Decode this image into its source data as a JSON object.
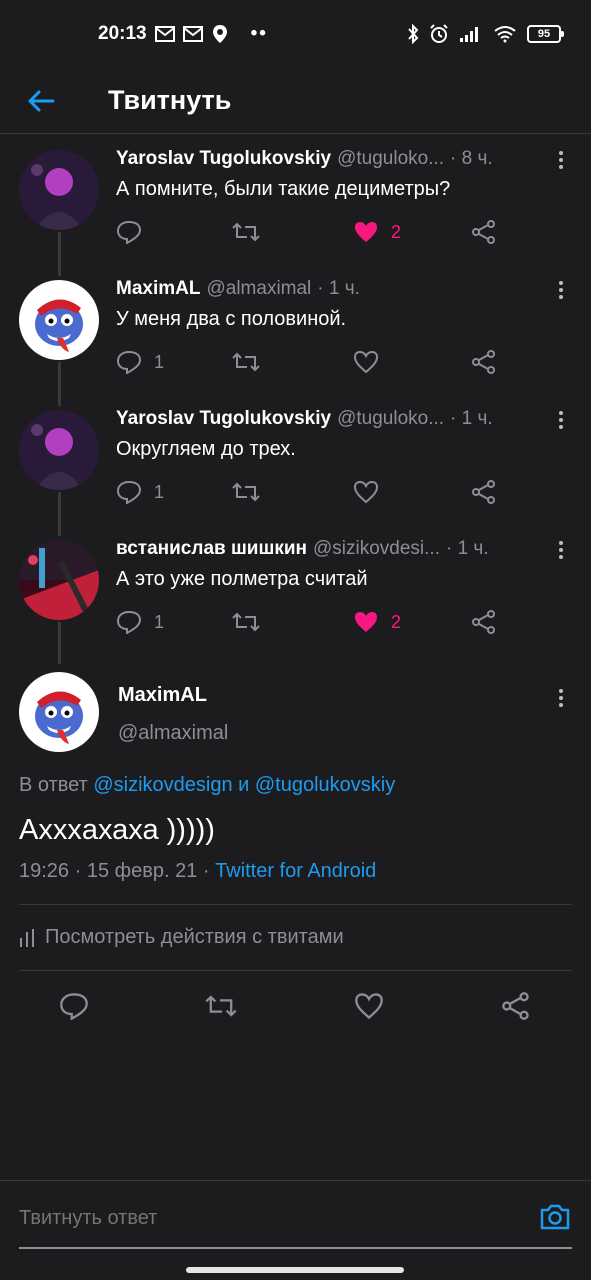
{
  "status": {
    "time": "20:13",
    "battery": "95"
  },
  "topbar": {
    "title": "Твитнуть"
  },
  "thread": [
    {
      "name": "Yaroslav Tugolukovskiy",
      "handle": "@tuguloko...",
      "time": "· 8 ч.",
      "text": "А помните, были такие дециметры?",
      "reply_count": "",
      "like_count": "2",
      "liked": true
    },
    {
      "name": "MaximAL",
      "handle": "@almaximal",
      "time": "· 1 ч.",
      "text": "У меня два с половиной.",
      "reply_count": "1",
      "like_count": "",
      "liked": false
    },
    {
      "name": "Yaroslav Tugolukovskiy",
      "handle": "@tuguloko...",
      "time": "· 1 ч.",
      "text": "Округляем до трех.",
      "reply_count": "1",
      "like_count": "",
      "liked": false
    },
    {
      "name": "встанислав шишкин",
      "handle": "@sizikovdesi...",
      "time": "· 1 ч.",
      "text": "А это уже полметра считай",
      "reply_count": "1",
      "like_count": "2",
      "liked": true
    }
  ],
  "main": {
    "name": "MaximAL",
    "handle": "@almaximal",
    "reply_prefix": "В ответ",
    "reply_user1": "@sizikovdesign",
    "reply_and": "и",
    "reply_user2": "@tugolukovskiy",
    "text": "Аxxxахаха )))))",
    "meta_time": "19:26 · 15 февр. 21 ·",
    "meta_source": "Twitter for Android",
    "analytics_label": "Посмотреть действия с твитами"
  },
  "compose": {
    "placeholder": "Твитнуть ответ"
  },
  "colors": {
    "accent": "#1d9bf0",
    "like": "#f91880",
    "background": "#1c1c1e",
    "muted": "#8e8e93"
  }
}
